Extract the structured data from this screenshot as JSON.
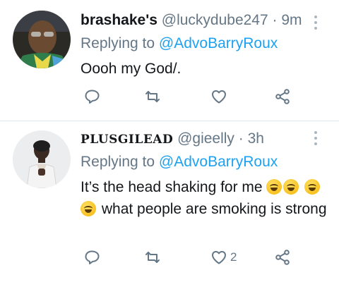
{
  "tweets": [
    {
      "display_name": "brashake's",
      "handle": "@luckydube247",
      "separator": "·",
      "time": "9m",
      "reply_prefix": "Replying to",
      "reply_to": "@AdvoBarryRoux",
      "text": "Oooh my God/.",
      "like_count": ""
    },
    {
      "display_name": "PLUSGILEAD",
      "handle": "@gieelly",
      "separator": "·",
      "time": "3h",
      "reply_prefix": "Replying to",
      "reply_to": "@AdvoBarryRoux",
      "text_part1": "It’s the head shaking for me",
      "text_part2": "what people are smoking is strong",
      "like_count": "2"
    }
  ],
  "icons": {
    "reply": "reply-bubble-icon",
    "retweet": "retweet-icon",
    "like": "heart-icon",
    "share": "share-icon",
    "more": "vertical-ellipsis-icon",
    "emoji": "rolling-on-floor-laughing-emoji"
  },
  "colors": {
    "accent": "#1da1f2",
    "muted": "#657786",
    "text": "#14171a",
    "divider": "#e1e8ed"
  }
}
